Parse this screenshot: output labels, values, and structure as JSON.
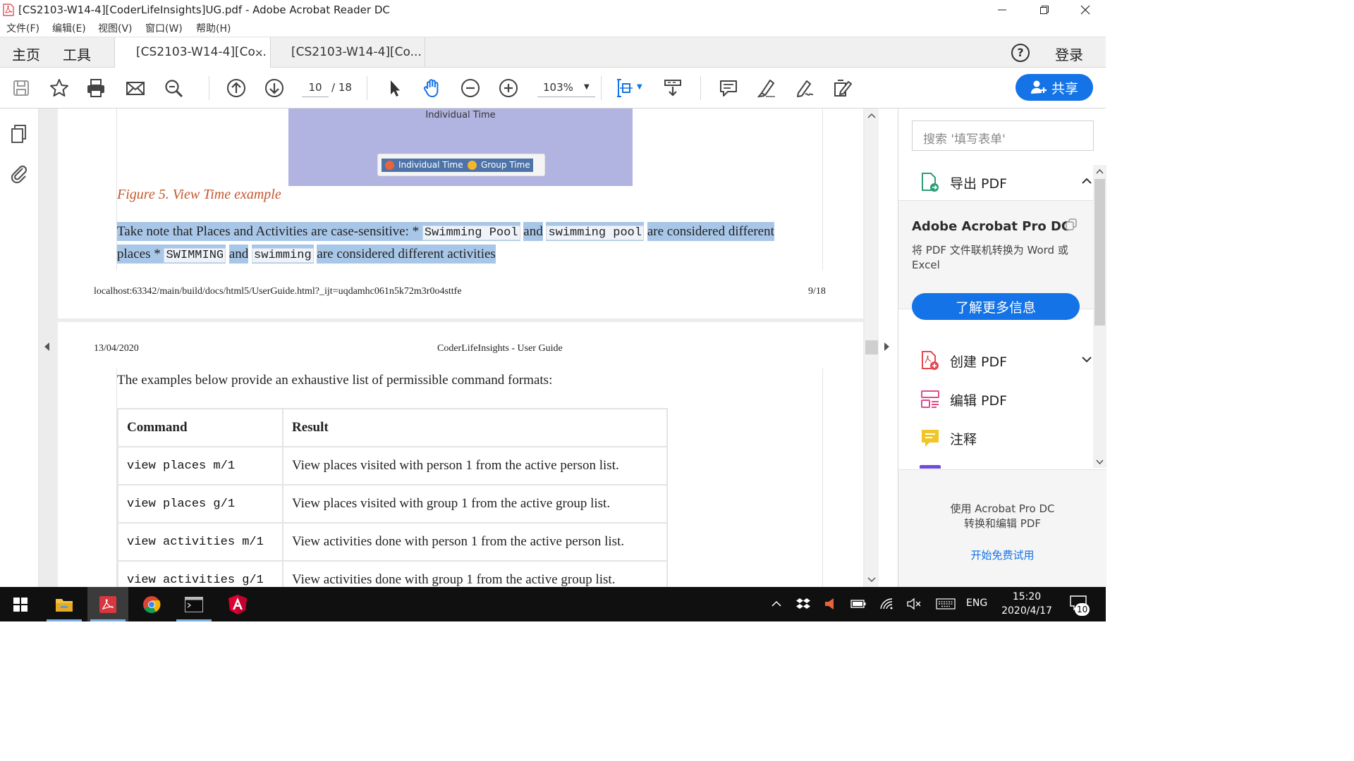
{
  "window": {
    "title": "[CS2103-W14-4][CoderLifeInsights]UG.pdf - Adobe Acrobat Reader DC"
  },
  "menu": [
    "文件(F)",
    "编辑(E)",
    "视图(V)",
    "窗口(W)",
    "帮助(H)"
  ],
  "tabs": {
    "home": "主页",
    "tools": "工具",
    "docs": [
      "[CS2103-W14-4][Co...",
      "[CS2103-W14-4][Co..."
    ],
    "close_glyph": "×",
    "help_glyph": "?",
    "login": "登录"
  },
  "toolbar": {
    "page_current": "10",
    "page_total": "/ 18",
    "zoom": "103%",
    "share_label": "共享",
    "icons": [
      "save-icon",
      "bookmark-star-icon",
      "print-icon",
      "email-icon",
      "find-icon",
      "prev-page-icon",
      "next-page-icon",
      "select-cursor-icon",
      "hand-icon",
      "zoom-out-icon",
      "zoom-in-icon",
      "fit-page-icon",
      "scroll-mode-icon",
      "comment-icon",
      "highlight-icon",
      "sign-icon",
      "more-tools-icon"
    ]
  },
  "doc": {
    "figure": {
      "axis_title": "Individual Time",
      "legend": [
        {
          "label": "Individual Time",
          "color": "#e8643a"
        },
        {
          "label": "Group Time",
          "color": "#f2b52c"
        }
      ]
    },
    "caption": "Figure 5. View Time example",
    "note": {
      "t1": "Take note that Places and Activities are case-sensitive: * ",
      "c1": "Swimming Pool",
      "t2": "and",
      "c2": "swimming pool",
      "t3": "are considered different places * ",
      "c3": "SWIMMING",
      "t4": "and",
      "c4": "swimming",
      "t5": "are considered different activities"
    },
    "footer_url": "localhost:63342/main/build/docs/html5/UserGuide.html?_ijt=uqdamhc061n5k72m3r0o4sttfe",
    "footer_page": "9/18",
    "header_date": "13/04/2020",
    "header_title": "CoderLifeInsights - User Guide",
    "intro": "The examples below provide an exhaustive list of permissible command formats:",
    "table": {
      "headers": [
        "Command",
        "Result"
      ],
      "rows": [
        [
          "view places m/1",
          "View places visited with person 1 from the active person list."
        ],
        [
          "view places g/1",
          "View places visited with group 1 from the active group list."
        ],
        [
          "view activities m/1",
          "View activities done with person 1 from the active person list."
        ],
        [
          "view activities g/1",
          "View activities done with group 1 from the active group list."
        ]
      ]
    }
  },
  "right_pane": {
    "search_placeholder": "搜索 '填写表单'",
    "export": "导出 PDF",
    "promo_title": "Adobe Acrobat Pro DC",
    "promo_desc": "将 PDF 文件联机转换为 Word 或 Excel",
    "promo_button": "了解更多信息",
    "create": "创建 PDF",
    "edit": "编辑 PDF",
    "comment": "注释",
    "promo2_text_1": "使用 Acrobat Pro DC",
    "promo2_text_2": "转换和编辑 PDF",
    "promo2_link": "开始免费试用"
  },
  "taskbar": {
    "apps": [
      "start-icon",
      "file-explorer-icon",
      "acrobat-icon",
      "chrome-icon",
      "terminal-icon",
      "angular-icon"
    ],
    "lang": "ENG",
    "time": "15:20",
    "date": "2020/4/17",
    "notifications": "10"
  },
  "colors": {
    "accent": "#1473e6",
    "caption": "#c4572d",
    "highlight": "#a8c7e8",
    "figure_bg": "#b1b4e0"
  }
}
